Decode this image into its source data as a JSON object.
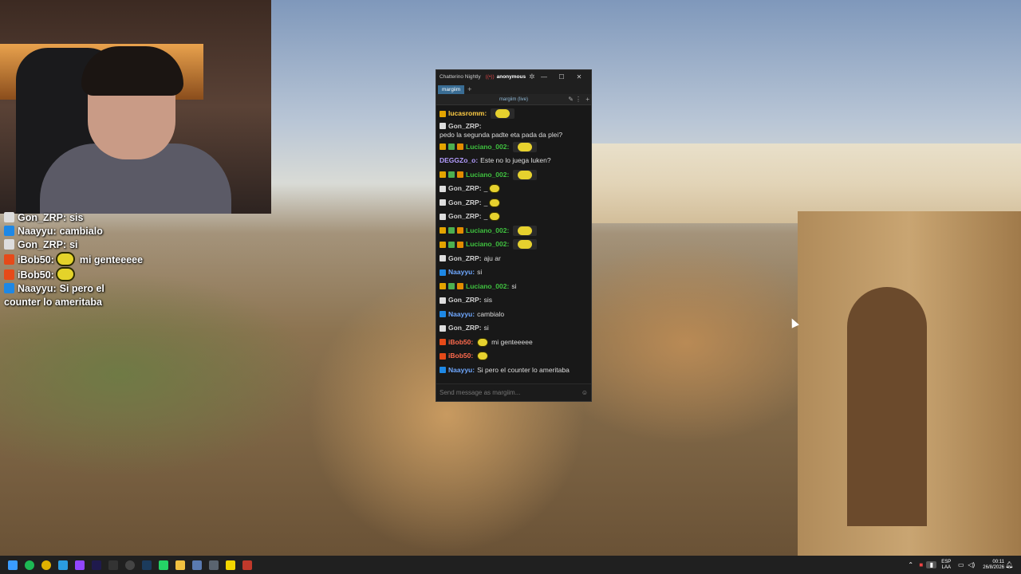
{
  "chatterino": {
    "title": "Chatterino Nightly",
    "user": "anonymous",
    "tab": "margiim",
    "split_header": "margiim (live)",
    "input_placeholder": "Send message as margiim...",
    "messages": [
      {
        "name": "lucasromm:",
        "color": "#ffcc44",
        "text": "",
        "badges": [
          "#e3a400"
        ],
        "emote": "wide"
      },
      {
        "name": "Gon_ZRP:",
        "color": "#cfcfcf",
        "text": "pedo la segunda padte eta pada da plei?",
        "badges": [
          "#dddddd"
        ],
        "emote": ""
      },
      {
        "name": "Luciano_002:",
        "color": "#3fc23f",
        "text": "",
        "badges": [
          "#e3a400",
          "#4caf50",
          "#e38b00"
        ],
        "emote": "wide"
      },
      {
        "name": "DEGGZo_o:",
        "color": "#b39dff",
        "text": "Este no lo juega luken?",
        "badges": [],
        "emote": ""
      },
      {
        "name": "Luciano_002:",
        "color": "#3fc23f",
        "text": "",
        "badges": [
          "#e3a400",
          "#4caf50",
          "#e38b00"
        ],
        "emote": "wide"
      },
      {
        "name": "Gon_ZRP:",
        "color": "#cfcfcf",
        "text": "_",
        "badges": [
          "#dddddd"
        ],
        "emote": "small"
      },
      {
        "name": "Gon_ZRP:",
        "color": "#cfcfcf",
        "text": "_",
        "badges": [
          "#dddddd"
        ],
        "emote": "small"
      },
      {
        "name": "Gon_ZRP:",
        "color": "#cfcfcf",
        "text": "_",
        "badges": [
          "#dddddd"
        ],
        "emote": "small"
      },
      {
        "name": "Luciano_002:",
        "color": "#3fc23f",
        "text": "",
        "badges": [
          "#e3a400",
          "#4caf50",
          "#e38b00"
        ],
        "emote": "wide"
      },
      {
        "name": "Luciano_002:",
        "color": "#3fc23f",
        "text": "",
        "badges": [
          "#e3a400",
          "#4caf50",
          "#e38b00"
        ],
        "emote": "wide"
      },
      {
        "name": "Gon_ZRP:",
        "color": "#cfcfcf",
        "text": "aju ar",
        "badges": [
          "#dddddd"
        ],
        "emote": ""
      },
      {
        "name": "Naayyu:",
        "color": "#6fa8ff",
        "text": "si",
        "badges": [
          "#1e88e5"
        ],
        "emote": ""
      },
      {
        "name": "Luciano_002:",
        "color": "#3fc23f",
        "text": "si",
        "badges": [
          "#e3a400",
          "#4caf50",
          "#e38b00"
        ],
        "emote": ""
      },
      {
        "name": "Gon_ZRP:",
        "color": "#cfcfcf",
        "text": "sis",
        "badges": [
          "#dddddd"
        ],
        "emote": ""
      },
      {
        "name": "Naayyu:",
        "color": "#6fa8ff",
        "text": "cambialo",
        "badges": [
          "#1e88e5"
        ],
        "emote": ""
      },
      {
        "name": "Gon_ZRP:",
        "color": "#cfcfcf",
        "text": "si",
        "badges": [
          "#dddddd"
        ],
        "emote": ""
      },
      {
        "name": "iBob50:",
        "color": "#ff6a4d",
        "text": "mi genteeeee",
        "badges": [
          "#e64a19"
        ],
        "emote": "small-before"
      },
      {
        "name": "iBob50:",
        "color": "#ff6a4d",
        "text": "",
        "badges": [
          "#e64a19"
        ],
        "emote": "small"
      },
      {
        "name": "Naayyu:",
        "color": "#6fa8ff",
        "text": "Si pero el counter lo ameritaba",
        "badges": [
          "#1e88e5"
        ],
        "emote": ""
      }
    ]
  },
  "overlay_chat": [
    {
      "name": "Gon_ZRP:",
      "text": "sis",
      "badge": "#dddddd",
      "emote": false
    },
    {
      "name": "Naayyu:",
      "text": "cambialo",
      "badge": "#1e88e5",
      "emote": false
    },
    {
      "name": "Gon_ZRP:",
      "text": "si",
      "badge": "#dddddd",
      "emote": false
    },
    {
      "name": "iBob50:",
      "text": "mi genteeeee",
      "badge": "#e64a19",
      "emote": true
    },
    {
      "name": "iBob50:",
      "text": "",
      "badge": "#e64a19",
      "emote": true
    },
    {
      "name": "Naayyu:",
      "text": "Si pero el counter lo ameritaba",
      "badge": "#1e88e5",
      "emote": false
    }
  ],
  "taskbar": {
    "lang_top": "ESP",
    "lang_bottom": "LAA",
    "time": "00:11",
    "date": "26/8/2026",
    "icons": [
      {
        "name": "start-icon",
        "color": "#3a9cff"
      },
      {
        "name": "spotify-icon",
        "color": "#1db954"
      },
      {
        "name": "chrome-icon",
        "color": "#e0b000"
      },
      {
        "name": "edge-icon",
        "color": "#2b9ce0"
      },
      {
        "name": "twitch-icon",
        "color": "#9146ff"
      },
      {
        "name": "premiere-icon",
        "color": "#1f1a4d"
      },
      {
        "name": "obs-icon",
        "color": "#333333"
      },
      {
        "name": "record-icon",
        "color": "#444444"
      },
      {
        "name": "steam-icon",
        "color": "#1b3b5c"
      },
      {
        "name": "whatsapp-icon",
        "color": "#25d366"
      },
      {
        "name": "folder-icon",
        "color": "#f0c040"
      },
      {
        "name": "chatterino-icon",
        "color": "#5a7ab0"
      },
      {
        "name": "file-icon",
        "color": "#5a6470"
      },
      {
        "name": "sticky-notes-icon",
        "color": "#f2d600"
      },
      {
        "name": "app-icon",
        "color": "#c0392b"
      }
    ]
  }
}
